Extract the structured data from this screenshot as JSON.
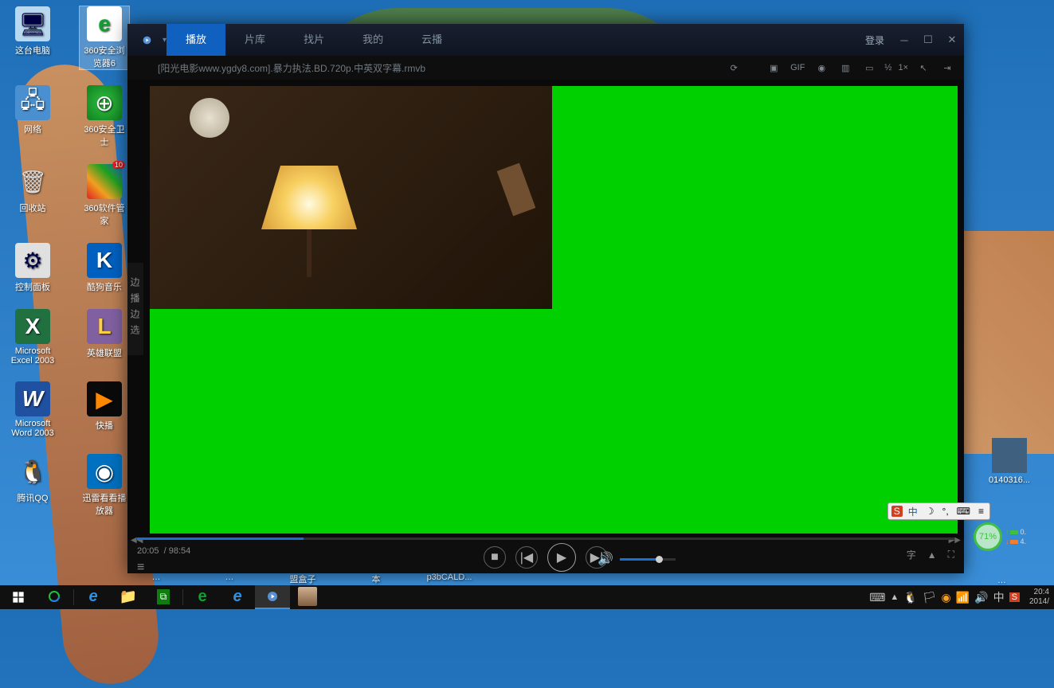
{
  "desktop_icons": {
    "row0": [
      {
        "label": "这台电脑",
        "emoji": "🖥"
      },
      {
        "label": "360安全浏览器6",
        "emoji": "e"
      }
    ],
    "row1": [
      {
        "label": "网络",
        "emoji": "🌐"
      },
      {
        "label": "360安全卫士",
        "emoji": "⊕"
      }
    ],
    "row2": [
      {
        "label": "回收站",
        "emoji": "🗑"
      },
      {
        "label": "360软件管家",
        "emoji": "▦",
        "badge": "10"
      }
    ],
    "row3": [
      {
        "label": "控制面板",
        "emoji": "⚙"
      },
      {
        "label": "酷狗音乐",
        "emoji": "K"
      }
    ],
    "row4": [
      {
        "label": "Microsoft Excel 2003",
        "emoji": "X"
      },
      {
        "label": "英雄联盟",
        "emoji": "L"
      }
    ],
    "row5": [
      {
        "label": "Microsoft Word 2003",
        "emoji": "W"
      },
      {
        "label": "快播",
        "emoji": "▶"
      }
    ],
    "row6": [
      {
        "label": "腾讯QQ",
        "emoji": "🐧"
      },
      {
        "label": "迅雷看看播放器",
        "emoji": "◉"
      }
    ]
  },
  "right_icon_label": "0140316...",
  "peek_labels": [
    "…",
    "…",
    "盟盒子",
    "本",
    "p3bCALD..."
  ],
  "peek_right": "…",
  "player": {
    "tabs": {
      "play": "播放",
      "library": "片库",
      "find": "找片",
      "my": "我的",
      "cloud": "云播"
    },
    "login": "登录",
    "filename": "[阳光电影www.ygdy8.com].暴力执法.BD.720p.中英双字幕.rmvb",
    "toolbar": {
      "half": "½",
      "one": "1×",
      "gif": "GIF"
    },
    "side_tab": "边播边选",
    "time_current": "20:05",
    "time_total": "98:54",
    "progress_percent": 20.4,
    "volume_percent": 65,
    "subtitle_btn": "字"
  },
  "ime": {
    "brand": "S",
    "lang": "中",
    "moon": "☽",
    "punct": "°,",
    "kbd": "⌨",
    "menu": "≡"
  },
  "battery": {
    "pct": "71%",
    "v1": "0.",
    "v2": "4."
  },
  "clock": {
    "time": "20:4",
    "date": "2014/"
  }
}
